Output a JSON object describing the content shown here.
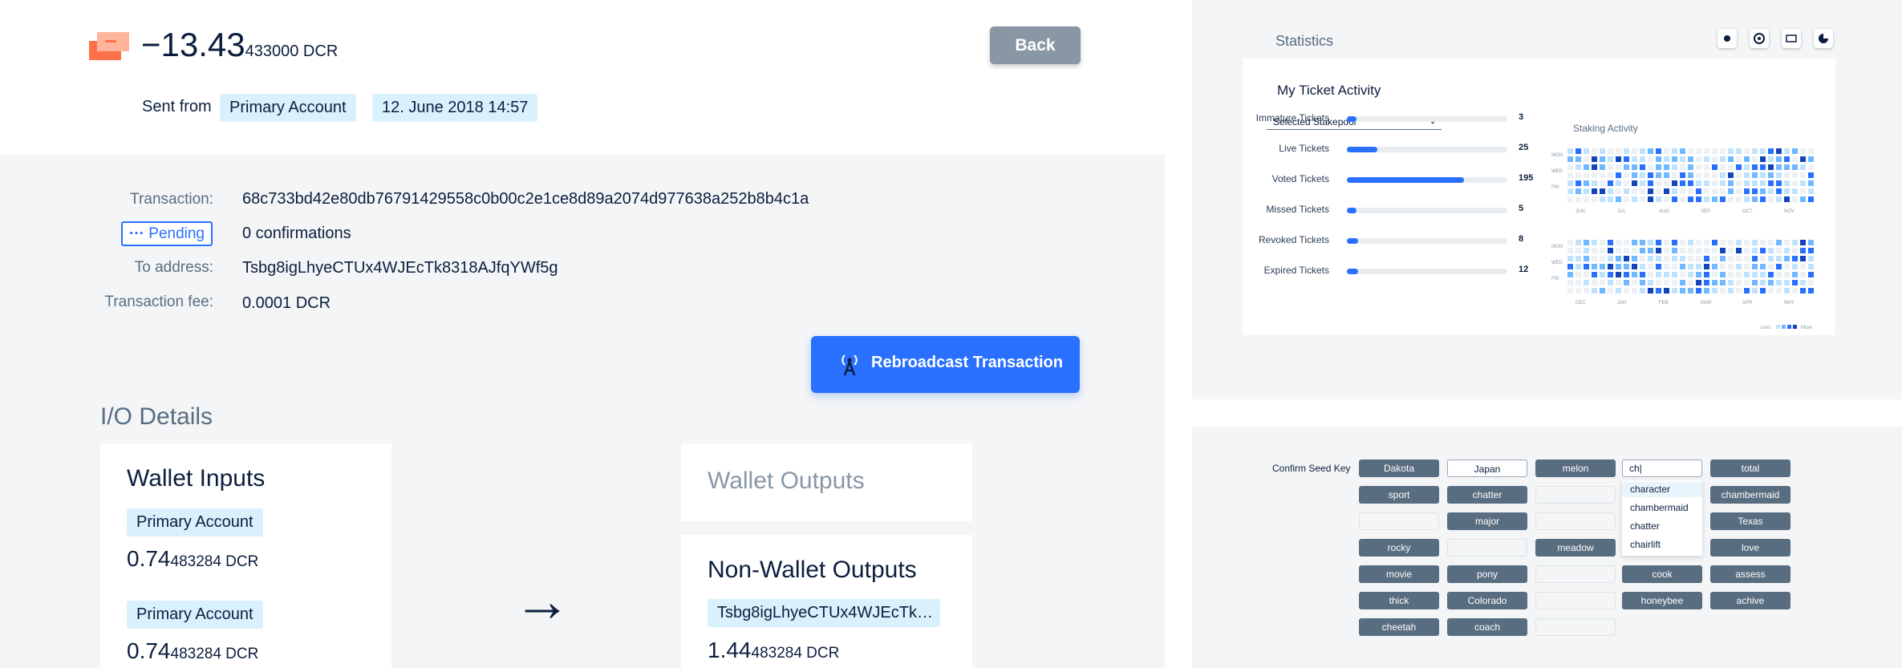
{
  "tx": {
    "amount_main": "−13.43",
    "amount_small": "433000 DCR",
    "sent_from_label": "Sent from",
    "account": "Primary Account",
    "date": "12. June 2018 14:57",
    "back_label": "Back"
  },
  "details": {
    "transaction_label": "Transaction:",
    "transaction_hash": "68c733bd42e80db76791429558c0b00c2e1ce8d89a2074d977638a252b8b4c1a",
    "pending_label": "Pending",
    "confirmations": "0 confirmations",
    "to_address_label": "To address:",
    "to_address": "Tsbg8igLhyeCTUx4WJEcTk8318AJfqYWf5g",
    "fee_label": "Transaction fee:",
    "fee": "0.0001 DCR",
    "rebroadcast_label": "Rebroadcast Transaction"
  },
  "io": {
    "title": "I/O Details",
    "wallet_inputs_title": "Wallet Inputs",
    "inputs": [
      {
        "account": "Primary Account",
        "amount_main": "0.74",
        "amount_small": "483284 DCR"
      },
      {
        "account": "Primary Account",
        "amount_main": "0.74",
        "amount_small": "483284 DCR"
      }
    ],
    "arrow": "→",
    "wallet_outputs_title": "Wallet Outputs",
    "non_wallet_outputs_title": "Non-Wallet Outputs",
    "output_address": "Tsbg8igLhyeCTUx4WJEcTk…",
    "output_amount_main": "1.44",
    "output_amount_small": "483284 DCR"
  },
  "stats": {
    "title": "Statistics",
    "card_title": "My Ticket Activity",
    "stakepool_select": "Selected Stakepool",
    "staking_activity": "Staking Activity",
    "rows": [
      {
        "label": "Immature Tickets",
        "value": "3",
        "fraction": 0.05
      },
      {
        "label": "Live Tickets",
        "value": "25",
        "fraction": 0.19
      },
      {
        "label": "Voted Tickets",
        "value": "195",
        "fraction": 0.73
      },
      {
        "label": "Missed Tickets",
        "value": "5",
        "fraction": 0.05
      },
      {
        "label": "Revoked Tickets",
        "value": "8",
        "fraction": 0.07
      },
      {
        "label": "Expired Tickets",
        "value": "12",
        "fraction": 0.07
      }
    ],
    "day_labels": [
      "MON",
      "WED",
      "FRI"
    ],
    "months_top": [
      "JUN",
      "JUL",
      "AUG",
      "SEP",
      "OCT",
      "NOV"
    ],
    "months_bottom": [
      "DEC",
      "JAN",
      "FEB",
      "MAR",
      "APR",
      "MAY"
    ],
    "legend_less": "Less",
    "legend_more": "More",
    "colors": {
      "accent": "#2970ff",
      "heat_levels": [
        "#eef1f4",
        "#bfe3ff",
        "#70b8ff",
        "#2970ff",
        "#1344b8"
      ]
    }
  },
  "seed": {
    "label": "Confirm Seed Key",
    "typed": "ch|",
    "suggestions": [
      "character",
      "chambermaid",
      "chatter",
      "chairlift"
    ],
    "columns": [
      [
        {
          "w": "Dakota",
          "s": "dark"
        },
        {
          "w": "sport",
          "s": "dark"
        },
        {
          "w": "",
          "s": "empty"
        },
        {
          "w": "rocky",
          "s": "dark"
        },
        {
          "w": "movie",
          "s": "dark"
        },
        {
          "w": "thick",
          "s": "dark"
        },
        {
          "w": "cheetah",
          "s": "dark"
        }
      ],
      [
        {
          "w": "Japan",
          "s": "light"
        },
        {
          "w": "chatter",
          "s": "dark"
        },
        {
          "w": "major",
          "s": "dark"
        },
        {
          "w": "",
          "s": "empty"
        },
        {
          "w": "pony",
          "s": "dark"
        },
        {
          "w": "Colorado",
          "s": "dark"
        },
        {
          "w": "coach",
          "s": "dark"
        }
      ],
      [
        {
          "w": "melon",
          "s": "dark"
        },
        {
          "w": "",
          "s": "empty"
        },
        {
          "w": "",
          "s": "empty"
        },
        {
          "w": "meadow",
          "s": "dark"
        },
        {
          "w": "",
          "s": "empty"
        },
        {
          "w": "",
          "s": "empty"
        },
        {
          "w": "",
          "s": "empty"
        }
      ],
      [
        {
          "w": "",
          "s": "none"
        },
        {
          "w": "",
          "s": "none"
        },
        {
          "w": "",
          "s": "none"
        },
        {
          "w": "",
          "s": "none"
        },
        {
          "w": "cook",
          "s": "dark"
        },
        {
          "w": "honeybee",
          "s": "dark"
        }
      ],
      [
        {
          "w": "total",
          "s": "dark"
        },
        {
          "w": "chambermaid",
          "s": "dark"
        },
        {
          "w": "Texas",
          "s": "dark"
        },
        {
          "w": "love",
          "s": "dark"
        },
        {
          "w": "assess",
          "s": "dark"
        },
        {
          "w": "achive",
          "s": "dark"
        }
      ]
    ]
  }
}
